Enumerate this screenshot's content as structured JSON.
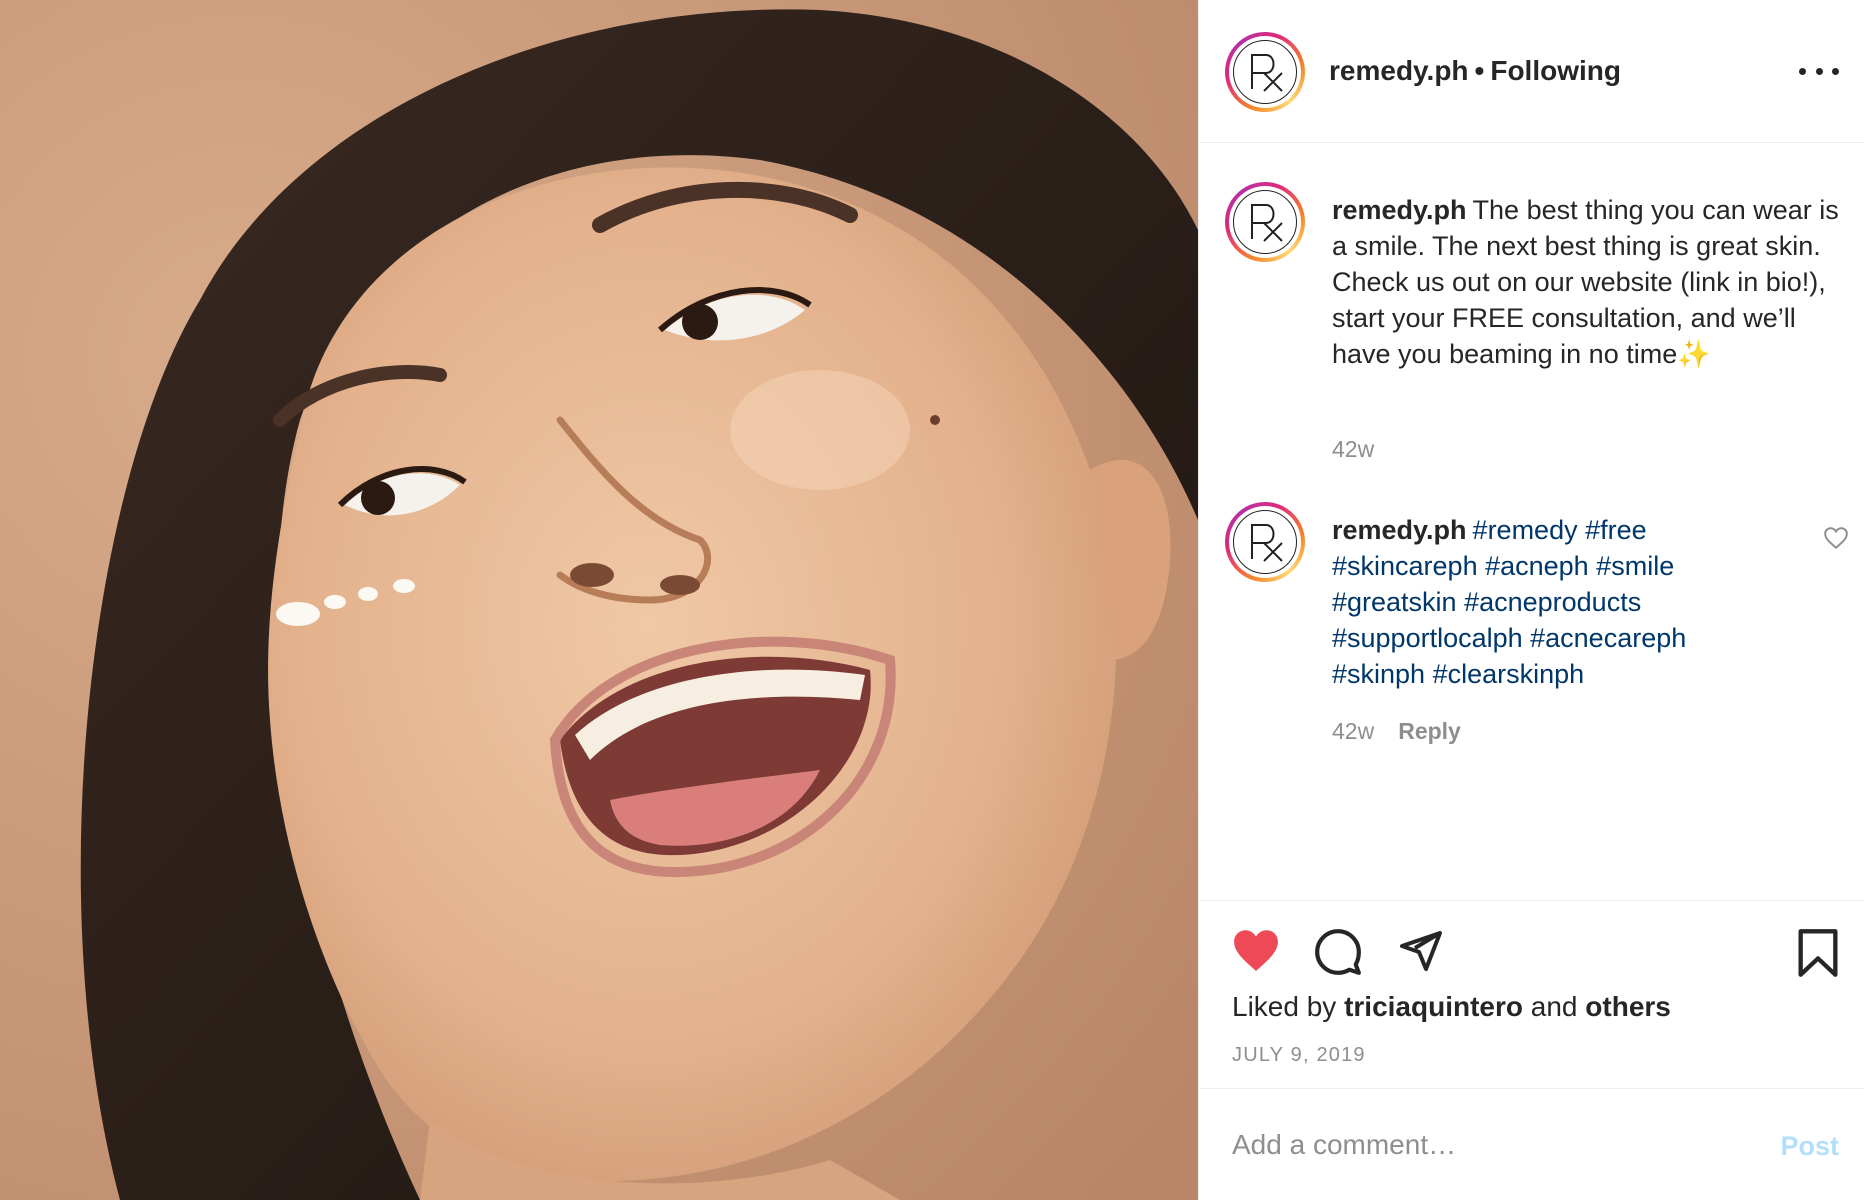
{
  "photo": {
    "alt_name": "woman-laughing-photo"
  },
  "header": {
    "username": "remedy.ph",
    "separator": "•",
    "follow_status": "Following"
  },
  "caption": {
    "username": "remedy.ph",
    "text": "The best thing you can wear is a smile. The next best thing is great skin. Check us out on our website (link in bio!), start your FREE consultation, and we’ll have you beaming in no time✨",
    "time": "42w"
  },
  "comment": {
    "username": "remedy.ph",
    "tags": "#remedy #free #skincareph #acneph #smile #greatskin #acneproducts #supportlocalph #acnecareph #skinph #clearskinph",
    "time": "42w",
    "reply_label": "Reply"
  },
  "actions": {
    "liked_prefix": "Liked by",
    "liked_user": "triciaquintero",
    "liked_and": "and",
    "liked_others": "others",
    "date": "JULY 9, 2019"
  },
  "add_comment": {
    "placeholder": "Add a comment…",
    "post_label": "Post"
  },
  "icons": {
    "like": "heart-filled-icon",
    "comment": "comment-icon",
    "share": "paper-plane-icon",
    "save": "bookmark-icon",
    "more": "more-options-icon"
  },
  "colors": {
    "like_red": "#ed4956",
    "hashtag_blue": "#00376b",
    "post_disabled": "#b2dffc",
    "muted": "#8e8e8e"
  }
}
